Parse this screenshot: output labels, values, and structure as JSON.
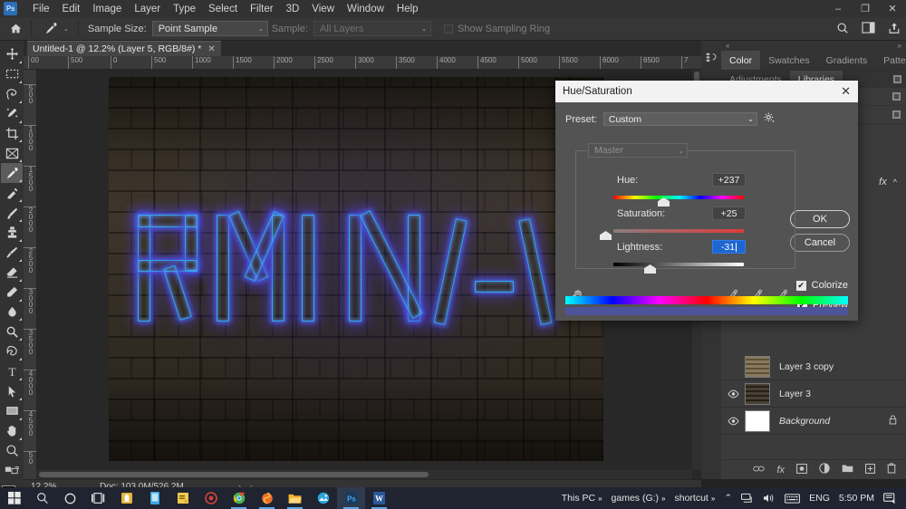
{
  "window": {
    "minimize": "–",
    "maximize": "❐",
    "close": "✕"
  },
  "menubar": {
    "logo": "Ps",
    "items": [
      "File",
      "Edit",
      "Image",
      "Layer",
      "Type",
      "Select",
      "Filter",
      "3D",
      "View",
      "Window",
      "Help"
    ]
  },
  "options_bar": {
    "home_icon": "home-icon",
    "tool_icon": "eyedropper-icon",
    "sample_size_label": "Sample Size:",
    "sample_size_value": "Point Sample",
    "sample_label": "Sample:",
    "sample_value": "All Layers",
    "show_sampling_ring": "Show Sampling Ring",
    "search_icon": "search-icon",
    "workspace_icon": "workspace-icon",
    "share_icon": "share-icon"
  },
  "toolbar": {
    "tools": [
      {
        "name": "move-tool",
        "active": false
      },
      {
        "name": "rectangular-marquee-tool",
        "active": false
      },
      {
        "name": "lasso-tool",
        "active": false
      },
      {
        "name": "quick-selection-tool",
        "active": false
      },
      {
        "name": "crop-tool",
        "active": false
      },
      {
        "name": "frame-tool",
        "active": false
      },
      {
        "name": "eyedropper-tool",
        "active": true
      },
      {
        "name": "spot-healing-brush-tool",
        "active": false
      },
      {
        "name": "brush-tool",
        "active": false
      },
      {
        "name": "clone-stamp-tool",
        "active": false
      },
      {
        "name": "history-brush-tool",
        "active": false
      },
      {
        "name": "eraser-tool",
        "active": false
      },
      {
        "name": "gradient-tool",
        "active": false
      },
      {
        "name": "blur-tool",
        "active": false
      },
      {
        "name": "dodge-tool",
        "active": false
      },
      {
        "name": "pen-tool",
        "active": false
      },
      {
        "name": "type-tool",
        "active": false
      },
      {
        "name": "path-selection-tool",
        "active": false
      },
      {
        "name": "rectangle-tool",
        "active": false
      },
      {
        "name": "hand-tool",
        "active": false
      },
      {
        "name": "zoom-tool",
        "active": false
      }
    ],
    "foreground_color": "#000000",
    "background_color": "#ffffff"
  },
  "document": {
    "tab_title": "Untitled-1 @ 12.2% (Layer 5, RGB/8#) *",
    "tab_close": "✕",
    "ruler_h": [
      "00",
      "500",
      "0",
      "500",
      "1000",
      "1500",
      "2000",
      "2500",
      "3000",
      "3500",
      "4000",
      "4500",
      "5000",
      "5500",
      "6000",
      "6500",
      "7"
    ],
    "ruler_v": [
      "500",
      "1000",
      "1500",
      "2000",
      "2500",
      "3000",
      "3500",
      "4000",
      "4500",
      "50"
    ],
    "canvas_alt": "neon sign letters on a dark brick wall",
    "neon_text": "RMI N A"
  },
  "statusbar": {
    "zoom": "12.2%",
    "doc_info": "Doc: 103.0M/526.2M",
    "arrow_right": "›",
    "arrow_left": "‹"
  },
  "right_panels": {
    "rail_icon_1": "panel-collapse-icon",
    "rail_icon_2": "color-wheel-icon",
    "collapse_left": "«",
    "collapse_right": "»",
    "tabs_row1": [
      "Color",
      "Swatches",
      "Gradients",
      "Patterns"
    ],
    "tabs_row1_active": "Color",
    "tabs_row2": [
      "Adjustments",
      "Libraries"
    ],
    "tabs_row2_active": "Libraries",
    "fx_badge": "fx",
    "fx_chevron": "^"
  },
  "layers_panel": {
    "rows": [
      {
        "name": "Layer 3 copy",
        "visible": false,
        "italic": false,
        "locked": false,
        "thumb": "texture"
      },
      {
        "name": "Layer 3",
        "visible": true,
        "italic": false,
        "locked": false,
        "thumb": "texture"
      },
      {
        "name": "Background",
        "visible": true,
        "italic": true,
        "locked": true,
        "thumb": "white"
      }
    ],
    "eye_icon": "eye-icon",
    "lock_icon": "lock-icon",
    "footer_icons": [
      "link-icon",
      "fx-icon",
      "mask-icon",
      "adjustment-icon",
      "group-icon",
      "new-layer-icon",
      "delete-icon"
    ]
  },
  "dialog": {
    "title": "Hue/Saturation",
    "close": "✕",
    "preset_label": "Preset:",
    "preset_value": "Custom",
    "preset_chevron": "⌄",
    "gear_icon": "gear-icon",
    "ok_label": "OK",
    "cancel_label": "Cancel",
    "channel_value": "Master",
    "channel_chevron": "⌄",
    "hue_label": "Hue:",
    "hue_value": "+237",
    "saturation_label": "Saturation:",
    "saturation_value": "+25",
    "lightness_label": "Lightness:",
    "lightness_value": "-31",
    "hand_icon": "hand-icon",
    "eyedropper_icon": "eyedropper-icon",
    "eyedropper_plus_icon": "eyedropper-plus-icon",
    "eyedropper_minus_icon": "eyedropper-minus-icon",
    "colorize_label": "Colorize",
    "colorize_checked": "✔",
    "preview_label": "Preview",
    "preview_checked": "✔"
  },
  "taskbar": {
    "start_icon": "windows-start-icon",
    "search_icon": "search-icon",
    "cortana_icon": "cortana-icon",
    "taskview_icon": "task-view-icon",
    "apps": [
      {
        "name": "store-icon",
        "color": "#f0c040"
      },
      {
        "name": "app-blue-icon",
        "color": "#4aa3df"
      },
      {
        "name": "sticky-notes-icon",
        "color": "#f2c94c"
      },
      {
        "name": "media-player-icon",
        "color": "#d8403a"
      },
      {
        "name": "chrome-icon",
        "color": "#4caf50"
      },
      {
        "name": "firefox-icon",
        "color": "#e8702a"
      },
      {
        "name": "file-explorer-icon",
        "color": "#f0b429"
      },
      {
        "name": "photos-icon",
        "color": "#2ea3d8"
      },
      {
        "name": "photoshop-icon",
        "color": "#2b6fb5"
      },
      {
        "name": "word-icon",
        "color": "#2b579a"
      }
    ],
    "tray_items": [
      "This PC",
      "games (G:)",
      "shortcut"
    ],
    "chevron": "»",
    "show_hidden": "⌃",
    "network_icon": "network-icon",
    "volume_icon": "volume-icon",
    "keyboard_icon": "keyboard-icon",
    "language": "ENG",
    "clock": "5:50 PM",
    "notifications_icon": "notifications-icon"
  }
}
